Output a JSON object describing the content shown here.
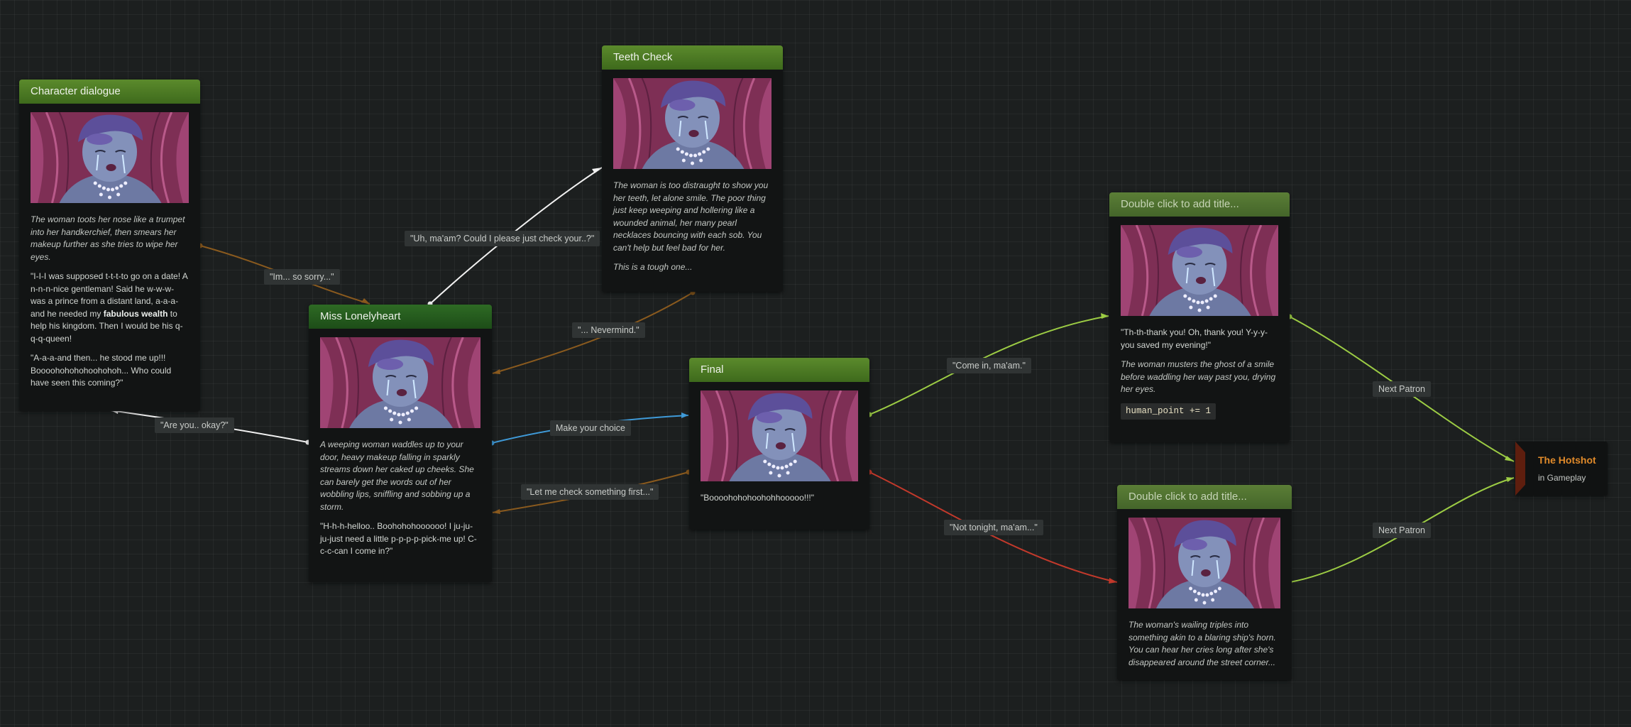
{
  "colors": {
    "white_wire": "#f2f2f2",
    "orange_wire": "#8a5a1e",
    "blue_wire": "#3f9ad8",
    "green_wire": "#9ccc44",
    "red_wire": "#c2392b",
    "hotshot_title": "#e08a2a"
  },
  "nodes": {
    "character_dialogue": {
      "title": "Character dialogue",
      "narration": "The woman toots her nose like a trumpet into her handkerchief, then smears her makeup further as she tries to wipe her eyes.",
      "quote1_a": "\"I-I-I was supposed t-t-t-to go on a date! A n-n-n-nice gentleman! Said he w-w-w-was a prince from a distant land, a-a-a-and he needed my ",
      "quote1_bold": "fabulous wealth",
      "quote1_b": " to help his kingdom. Then I would be his q-q-q-queen!",
      "quote2": "\"A-a-a-and then... he stood me up!!! Boooohohohohoohohoh... Who could have seen this coming?\""
    },
    "teeth_check": {
      "title": "Teeth Check",
      "narration": "The woman is too distraught to show you her teeth, let alone smile. The poor thing just keep weeping and hollering like a wounded animal, her many pearl necklaces bouncing with each sob. You can't help but feel bad for her.",
      "narration2": "This is a tough one..."
    },
    "miss_lonelyheart": {
      "title": "Miss Lonelyheart",
      "narration": "A weeping woman waddles up to your door, heavy makeup falling in sparkly streams down her caked up cheeks. She can barely get the words out of her wobbling lips, sniffling and sobbing up a storm.",
      "quote": "\"H-h-h-helloo.. Boohohohoooooo! I ju-ju-ju-just need a little p-p-p-p-pick-me up! C-c-c-can I come in?\""
    },
    "final": {
      "title": "Final",
      "quote": "\"Boooohohohoohohhooooo!!!\""
    },
    "double_top": {
      "title": "Double click to add title...",
      "quote": "\"Th-th-thank you! Oh, thank you! Y-y-y-you saved my evening!\"",
      "narration": "The woman musters the ghost of a smile before waddling her way past you, drying her eyes.",
      "code": "human_point += 1"
    },
    "double_bottom": {
      "title": "Double click to add title...",
      "narration": "The woman's wailing triples into something akin to a blaring ship's horn. You can hear her cries long after she's disappeared around the street corner..."
    },
    "hotshot": {
      "title": "The Hotshot",
      "subtitle": "in Gameplay"
    }
  },
  "labels": {
    "sorry": "\"Im... so sorry...\"",
    "check_teeth": "\"Uh, ma'am? Could I please just check your..?\"",
    "nevermind": "\"... Nevermind.\"",
    "are_you_okay": "\"Are you.. okay?\"",
    "make_choice": "Make your choice",
    "check_first": "\"Let me check something first...\"",
    "come_in": "\"Come in, ma'am.\"",
    "not_tonight": "\"Not tonight, ma'am...\"",
    "next_patron_top": "Next Patron",
    "next_patron_bottom": "Next Patron"
  }
}
